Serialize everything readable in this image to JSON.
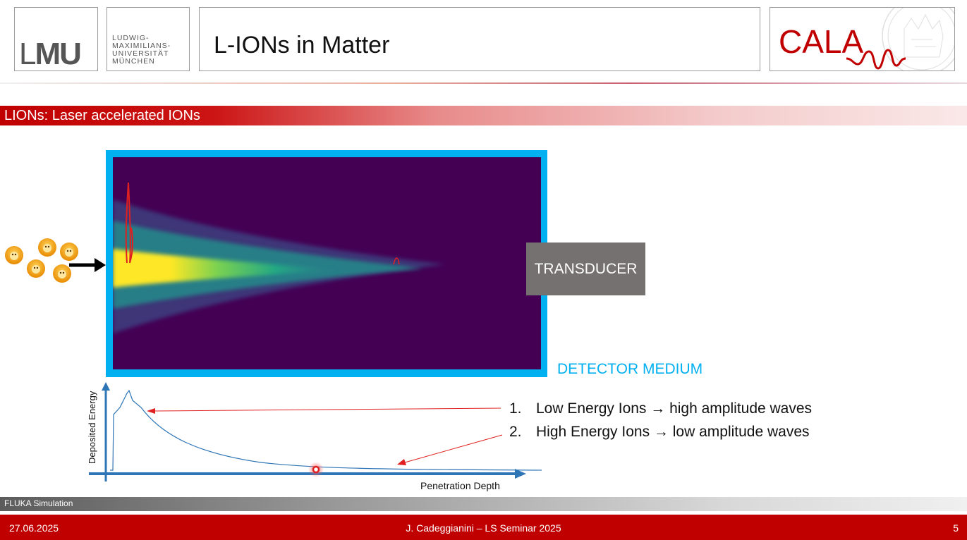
{
  "header": {
    "logo_text_left": "L",
    "logo_text_right": "MU",
    "university_lines": [
      "LUDWIG-",
      "MAXIMILIANS-",
      "UNIVERSITÄT",
      "MÜNCHEN"
    ],
    "slide_title": "L-IONs in Matter",
    "cala_logo": "CALA"
  },
  "section": {
    "title": "LIONs: Laser accelerated IONs"
  },
  "figure": {
    "transducer_label": "TRANSDUCER",
    "detector_label": "DETECTOR MEDIUM",
    "y_axis_label": "Deposited Energy",
    "x_axis_label": "Penetration Depth",
    "colors": {
      "frame": "#00b0f0",
      "background": "#440154",
      "arrow_red": "#e02020",
      "axis": "#2e75b6"
    }
  },
  "points": [
    {
      "num": "1.",
      "text": "Low Energy Ions → high amplitude waves"
    },
    {
      "num": "2.",
      "text": "High Energy Ions → low amplitude waves"
    }
  ],
  "caption": "FLUKA Simulation",
  "footer": {
    "date": "27.06.2025",
    "presenter": "J. Cadeggianini – LS Seminar 2025",
    "page": "5"
  }
}
